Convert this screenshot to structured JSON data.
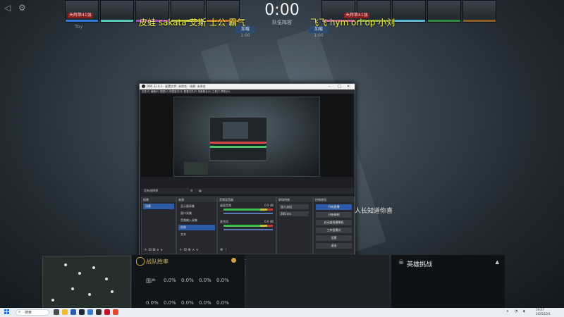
{
  "hud": {
    "clock": "0:00",
    "clock_subtitle": "队伍阵容",
    "left_tag": "天辉第41强",
    "right_tag": "天辉第41强",
    "player_name": "Toy",
    "timer_label": "加载",
    "timer_values": [
      "1:00",
      "1:00"
    ]
  },
  "danmu": {
    "left": "皮蛙 sakata 艾斯 士公 霸气",
    "right": "飞飞 hym orl op 小刘"
  },
  "obs": {
    "title": "OBS 32.0.1 - 配置文件: 未命名 - 场景: 未命名",
    "menu": "文件(F)  编辑(E)  视图(V)  停靠窗口(D)  配置文件(P)  场景集合(S)  工具(T)  帮助(H)",
    "source_bar_label": "没有选择源",
    "docks": {
      "scenes": "场景",
      "sources": "来源",
      "mixer": "音频混音器",
      "transitions": "转场特效",
      "controls": "控制按钮"
    },
    "scene_items": [
      "场景"
    ],
    "source_items": [
      "显示器采集",
      "窗口采集",
      "音频输入采集",
      "图像",
      "文本"
    ],
    "mixer_channels": [
      {
        "name": "桌面音频",
        "level": "0.0 dB"
      },
      {
        "name": "麦克风",
        "level": "0.0 dB"
      }
    ],
    "transition": "淡入淡出",
    "transition_duration": "300 ms",
    "control_buttons": [
      "开始直播",
      "开始录制",
      "启动虚拟摄像机",
      "工作室模式",
      "设置",
      "退出"
    ]
  },
  "overlay_text": "人长知道你喜",
  "panels": {
    "left_title": "战队胜率",
    "row1_label": "国产",
    "row1": [
      "0.0%",
      "0.0%",
      "0.0%",
      "0.0%",
      "0.0%"
    ],
    "row2": [
      "0.0%",
      "0.0%",
      "0.0%",
      "0.0%",
      "0.0%"
    ],
    "right_title": "英雄挑战"
  },
  "taskbar": {
    "search_placeholder": "搜索",
    "time": "19:47",
    "date": "2025/10/1"
  }
}
